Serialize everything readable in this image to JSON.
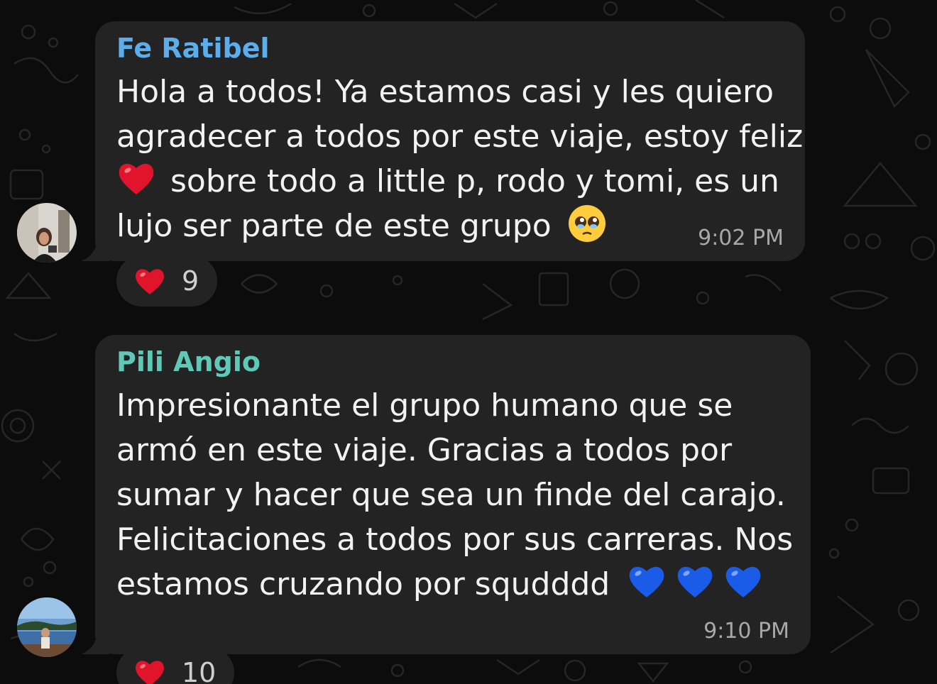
{
  "messages": [
    {
      "sender": "Fe Ratibel",
      "sender_color": "#5cadec",
      "lines": [
        "Hola a todos! Ya estamos casi y les quiero",
        "agradecer a todos por este viaje, estoy feliz",
        "sobre todo a little p, rodo y tomi, es un",
        "lujo ser parte de este grupo"
      ],
      "emojis": [
        "red-heart",
        "pleading-face"
      ],
      "time": "9:02 PM",
      "reaction": {
        "emoji": "red-heart",
        "count": "9"
      }
    },
    {
      "sender": "Pili Angio",
      "sender_color": "#5fc9b7",
      "lines": [
        "Impresionante el grupo humano que se",
        "armó en este viaje. Gracias a todos por",
        "sumar y hacer que sea un finde del carajo.",
        "Felicitaciones a todos por sus carreras. Nos",
        "estamos cruzando por squdddd"
      ],
      "emojis": [
        "blue-heart",
        "blue-heart",
        "blue-heart"
      ],
      "time": "9:10 PM",
      "reaction": {
        "emoji": "red-heart",
        "count": "10"
      }
    }
  ],
  "colors": {
    "background": "#0c0c0c",
    "bubble": "#232323",
    "text": "#f2f2f2",
    "timestamp": "#a8a8a8",
    "red_heart": "#e0142a",
    "blue_heart": "#1a5be8"
  }
}
